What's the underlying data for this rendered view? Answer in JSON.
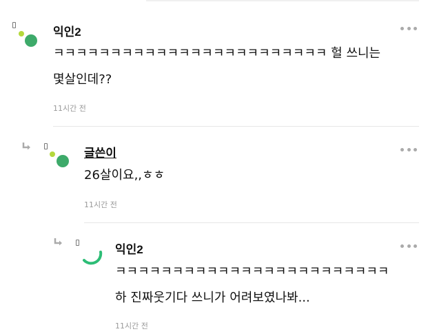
{
  "comments": [
    {
      "nickname": "익인2",
      "lines": [
        "ㅋㅋㅋㅋㅋㅋㅋㅋㅋㅋㅋㅋㅋㅋㅋㅋㅋㅋㅋㅋㅋㅋㅋㅋ 헐 쓰니는",
        "몇살인데??"
      ],
      "time": "11시간 전"
    },
    {
      "nickname": "글쓴이",
      "lines": [
        "26살이요,,ㅎㅎ"
      ],
      "time": "11시간 전"
    },
    {
      "nickname": "익인2",
      "lines": [
        "ㅋㅋㅋㅋㅋㅋㅋㅋㅋㅋㅋㅋㅋㅋㅋㅋㅋㅋㅋㅋㅋㅋㅋㅋ",
        "하 진짜웃기다 쓰니가 어려보였나봐..."
      ],
      "time": "11시간 전"
    }
  ],
  "icons": {
    "more": "more-options-icon",
    "reply": "reply-arrow-icon",
    "avatar": "avatar"
  },
  "colors": {
    "avatar_green": "#3daa6a",
    "avatar_lime": "#b4d83c",
    "time_gray": "#999999",
    "divider": "#e6e6e6"
  }
}
